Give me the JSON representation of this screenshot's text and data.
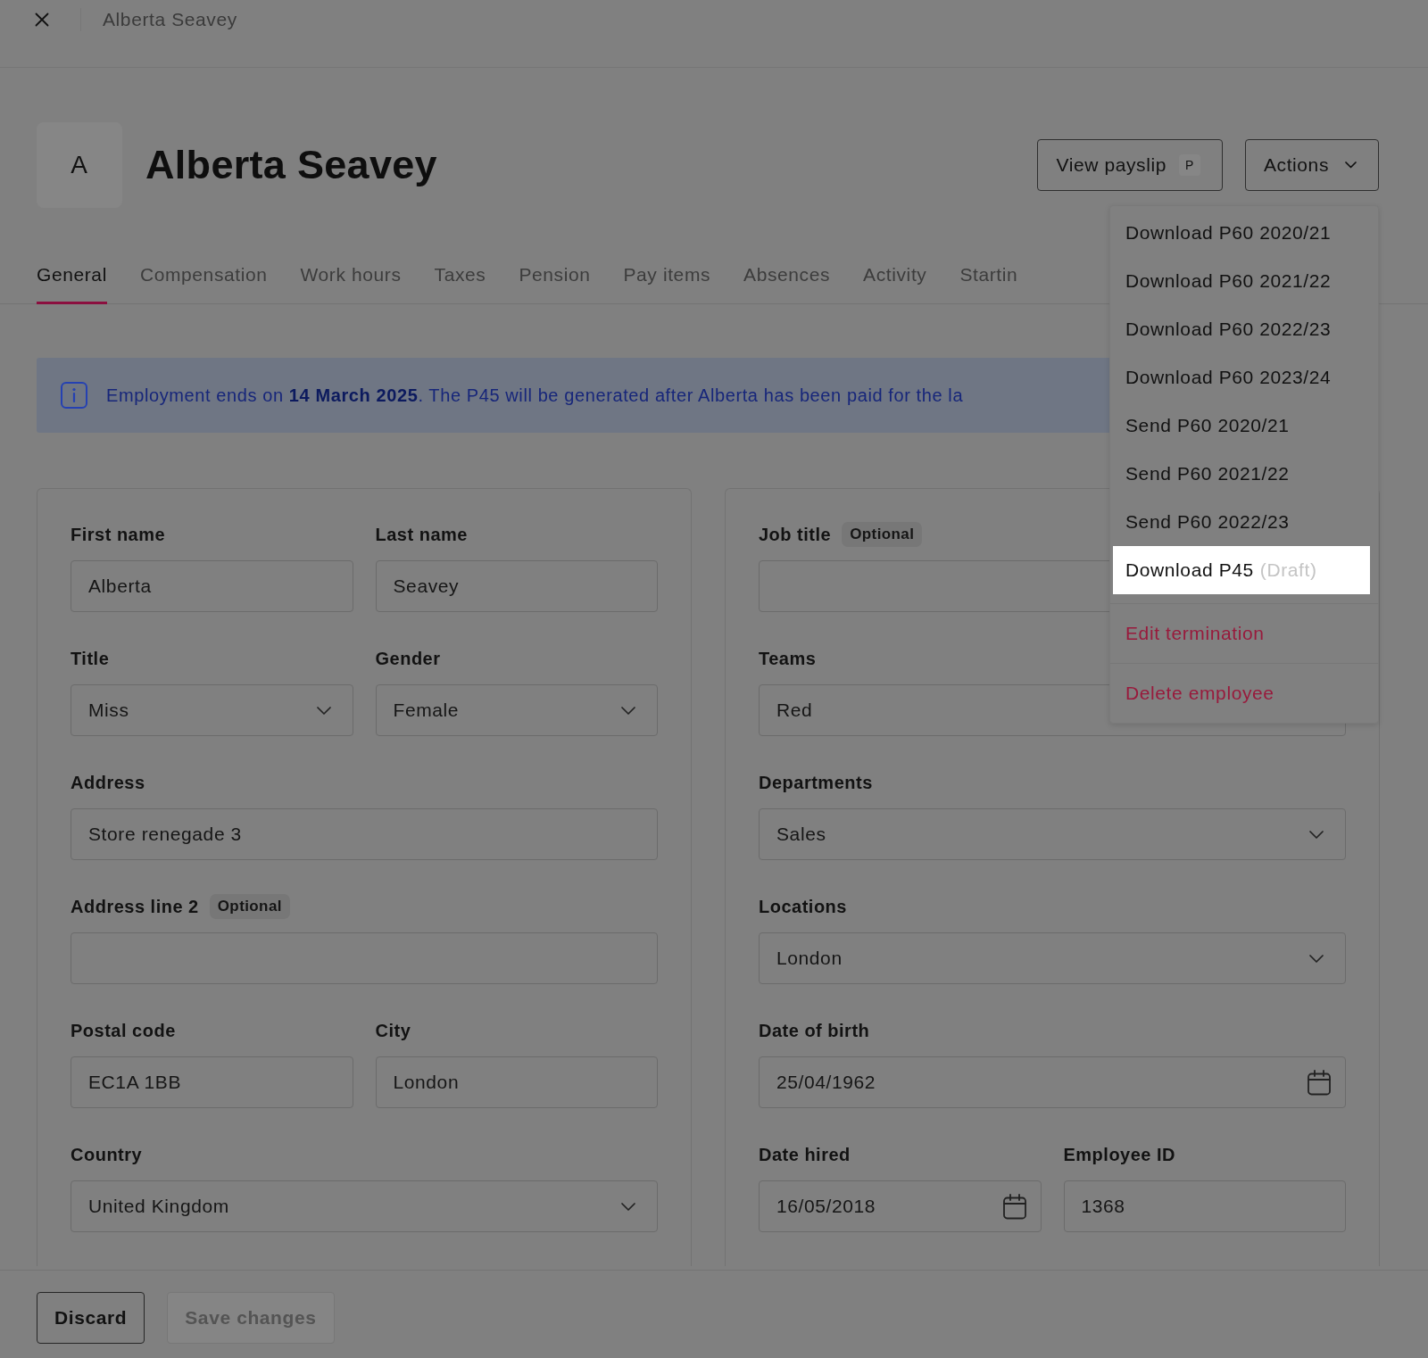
{
  "top_bar": {
    "title": "Alberta Seavey"
  },
  "header": {
    "avatar_initial": "A",
    "name": "Alberta Seavey",
    "buttons": [
      {
        "label": "View payslip",
        "kind": "shortcut",
        "shortcut": "P"
      },
      {
        "label": "Actions",
        "kind": "dropdown"
      }
    ]
  },
  "tabs": [
    {
      "label": "General",
      "selected": true
    },
    {
      "label": "Compensation",
      "selected": false
    },
    {
      "label": "Work hours",
      "selected": false
    },
    {
      "label": "Taxes",
      "selected": false
    },
    {
      "label": "Pension",
      "selected": false
    },
    {
      "label": "Pay items",
      "selected": false
    },
    {
      "label": "Absences",
      "selected": false
    },
    {
      "label": "Activity",
      "selected": false
    },
    {
      "label": "Startin",
      "selected": false
    }
  ],
  "banner": {
    "text": "Employment ends on **14 March 2025**. The P45 will be generated after Alberta has been paid for the la"
  },
  "cards": [
    {
      "rows": [
        [
          {
            "label": "First name",
            "kind": "text",
            "value": "Alberta"
          },
          {
            "label": "Last name",
            "kind": "text",
            "value": "Seavey"
          }
        ],
        [
          {
            "label": "Title",
            "kind": "select",
            "value": "Miss"
          },
          {
            "label": "Gender",
            "kind": "select",
            "value": "Female"
          }
        ],
        [
          {
            "label": "Address",
            "kind": "text",
            "value": "Store renegade 3"
          }
        ],
        [
          {
            "label": "Address line 2",
            "tag": "Optional",
            "kind": "text"
          }
        ],
        [
          {
            "label": "Postal code",
            "kind": "text",
            "value": "EC1A 1BB"
          },
          {
            "label": "City",
            "kind": "text",
            "value": "London"
          }
        ],
        [
          {
            "label": "Country",
            "kind": "select",
            "value": "United Kingdom"
          }
        ]
      ]
    },
    {
      "rows": [
        [
          {
            "label": "Job title",
            "tag": "Optional",
            "kind": "text"
          }
        ],
        [
          {
            "label": "Teams",
            "kind": "text",
            "value": "Red"
          }
        ],
        [
          {
            "label": "Departments",
            "kind": "select",
            "value": "Sales"
          }
        ],
        [
          {
            "label": "Locations",
            "kind": "select",
            "value": "London"
          }
        ],
        [
          {
            "label": "Date of birth",
            "kind": "date",
            "value": "25/04/1962"
          }
        ],
        [
          {
            "label": "Date hired",
            "kind": "date",
            "value": "16/05/2018"
          },
          {
            "label": "Employee ID",
            "kind": "text",
            "value": "1368"
          }
        ]
      ]
    }
  ],
  "menu": {
    "sections": [
      {
        "items": [
          {
            "label": "Download P60 2020/21",
            "kind": "default",
            "selected": false
          },
          {
            "label": "Download P60 2021/22",
            "kind": "default",
            "selected": false
          },
          {
            "label": "Download P60 2022/23",
            "kind": "default",
            "selected": false
          },
          {
            "label": "Download P60 2023/24",
            "kind": "default",
            "selected": false
          },
          {
            "label": "Send P60 2020/21",
            "kind": "default",
            "selected": false
          },
          {
            "label": "Send P60 2021/22",
            "kind": "default",
            "selected": false
          },
          {
            "label": "Send P60 2022/23",
            "kind": "default",
            "selected": false
          },
          {
            "label": "Download P45",
            "note": "(Draft)",
            "kind": "default",
            "selected": true
          }
        ]
      },
      {
        "items": [
          {
            "label": "Edit termination",
            "kind": "danger",
            "selected": false
          }
        ]
      },
      {
        "items": [
          {
            "label": "Delete employee",
            "kind": "danger",
            "selected": false
          }
        ]
      }
    ]
  },
  "footer": {
    "buttons": [
      {
        "label": "Discard",
        "disabled": false
      },
      {
        "label": "Save changes",
        "disabled": true
      }
    ]
  }
}
